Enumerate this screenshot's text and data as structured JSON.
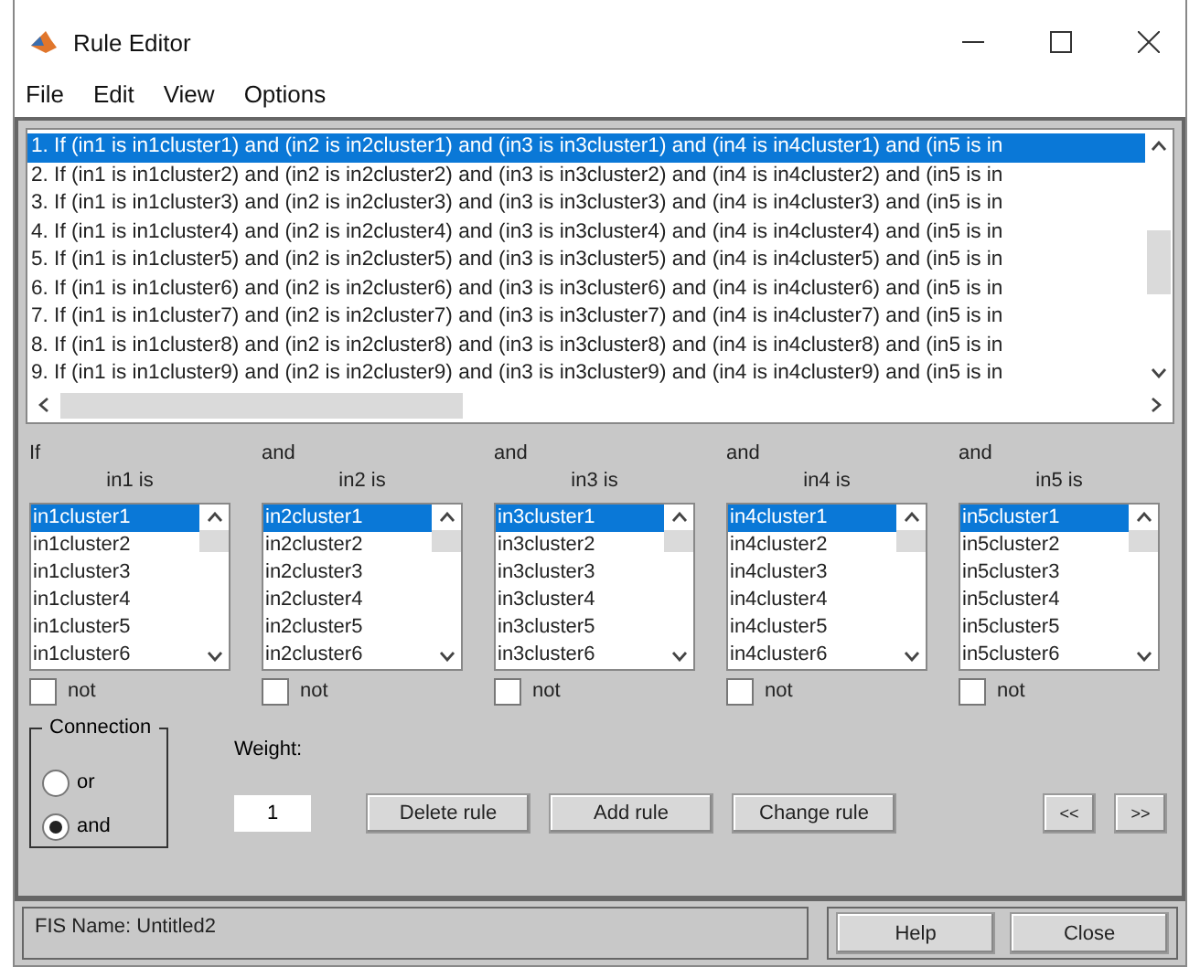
{
  "window": {
    "title": "Rule Editor"
  },
  "menu": [
    "File",
    "Edit",
    "View",
    "Options"
  ],
  "rules": [
    {
      "text": "1. If (in1 is in1cluster1) and (in2 is in2cluster1) and (in3 is in3cluster1) and (in4 is in4cluster1) and (in5 is in",
      "selected": true
    },
    {
      "text": "2. If (in1 is in1cluster2) and (in2 is in2cluster2) and (in3 is in3cluster2) and (in4 is in4cluster2) and (in5 is in",
      "selected": false
    },
    {
      "text": "3. If (in1 is in1cluster3) and (in2 is in2cluster3) and (in3 is in3cluster3) and (in4 is in4cluster3) and (in5 is in",
      "selected": false
    },
    {
      "text": "4. If (in1 is in1cluster4) and (in2 is in2cluster4) and (in3 is in3cluster4) and (in4 is in4cluster4) and (in5 is in",
      "selected": false
    },
    {
      "text": "5. If (in1 is in1cluster5) and (in2 is in2cluster5) and (in3 is in3cluster5) and (in4 is in4cluster5) and (in5 is in",
      "selected": false
    },
    {
      "text": "6. If (in1 is in1cluster6) and (in2 is in2cluster6) and (in3 is in3cluster6) and (in4 is in4cluster6) and (in5 is in",
      "selected": false
    },
    {
      "text": "7. If (in1 is in1cluster7) and (in2 is in2cluster7) and (in3 is in3cluster7) and (in4 is in4cluster7) and (in5 is in",
      "selected": false
    },
    {
      "text": "8. If (in1 is in1cluster8) and (in2 is in2cluster8) and (in3 is in3cluster8) and (in4 is in4cluster8) and (in5 is in",
      "selected": false
    },
    {
      "text": "9. If (in1 is in1cluster9) and (in2 is in2cluster9) and (in3 is in3cluster9) and (in4 is in4cluster9) and (in5 is in",
      "selected": false
    }
  ],
  "inputs": [
    {
      "connector": "If",
      "label": "in1 is",
      "options": [
        {
          "text": "in1cluster1",
          "selected": true
        },
        {
          "text": "in1cluster2",
          "selected": false
        },
        {
          "text": "in1cluster3",
          "selected": false
        },
        {
          "text": "in1cluster4",
          "selected": false
        },
        {
          "text": "in1cluster5",
          "selected": false
        },
        {
          "text": "in1cluster6",
          "selected": false
        }
      ],
      "not_label": "not",
      "not_checked": false
    },
    {
      "connector": "and",
      "label": "in2 is",
      "options": [
        {
          "text": "in2cluster1",
          "selected": true
        },
        {
          "text": "in2cluster2",
          "selected": false
        },
        {
          "text": "in2cluster3",
          "selected": false
        },
        {
          "text": "in2cluster4",
          "selected": false
        },
        {
          "text": "in2cluster5",
          "selected": false
        },
        {
          "text": "in2cluster6",
          "selected": false
        }
      ],
      "not_label": "not",
      "not_checked": false
    },
    {
      "connector": "and",
      "label": "in3 is",
      "options": [
        {
          "text": "in3cluster1",
          "selected": true
        },
        {
          "text": "in3cluster2",
          "selected": false
        },
        {
          "text": "in3cluster3",
          "selected": false
        },
        {
          "text": "in3cluster4",
          "selected": false
        },
        {
          "text": "in3cluster5",
          "selected": false
        },
        {
          "text": "in3cluster6",
          "selected": false
        }
      ],
      "not_label": "not",
      "not_checked": false
    },
    {
      "connector": "and",
      "label": "in4 is",
      "options": [
        {
          "text": "in4cluster1",
          "selected": true
        },
        {
          "text": "in4cluster2",
          "selected": false
        },
        {
          "text": "in4cluster3",
          "selected": false
        },
        {
          "text": "in4cluster4",
          "selected": false
        },
        {
          "text": "in4cluster5",
          "selected": false
        },
        {
          "text": "in4cluster6",
          "selected": false
        }
      ],
      "not_label": "not",
      "not_checked": false
    },
    {
      "connector": "and",
      "label": "in5 is",
      "options": [
        {
          "text": "in5cluster1",
          "selected": true
        },
        {
          "text": "in5cluster2",
          "selected": false
        },
        {
          "text": "in5cluster3",
          "selected": false
        },
        {
          "text": "in5cluster4",
          "selected": false
        },
        {
          "text": "in5cluster5",
          "selected": false
        },
        {
          "text": "in5cluster6",
          "selected": false
        }
      ],
      "not_label": "not",
      "not_checked": false
    }
  ],
  "connection": {
    "title": "Connection",
    "options": [
      {
        "label": "or",
        "selected": false
      },
      {
        "label": "and",
        "selected": true
      }
    ]
  },
  "weight": {
    "label": "Weight:",
    "value": "1"
  },
  "actions": [
    "Delete rule",
    "Add rule",
    "Change rule"
  ],
  "nav": [
    "<<",
    ">>"
  ],
  "status": {
    "fis_name": "FIS Name: Untitled2"
  },
  "footer_buttons": [
    "Help",
    "Close"
  ]
}
